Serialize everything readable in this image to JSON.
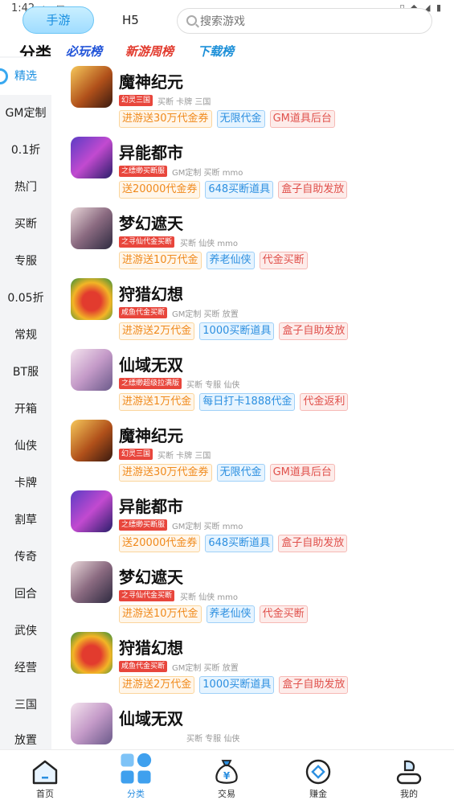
{
  "status_bar": {
    "time": "1:42"
  },
  "top_tabs": {
    "mobile_game": "手游",
    "h5": "H5"
  },
  "search": {
    "placeholder": "搜索游戏"
  },
  "category_header": {
    "title": "分类",
    "rank_must_play": "必玩榜",
    "rank_new_games": "新游周榜",
    "rank_downloads": "下载榜"
  },
  "sidebar": {
    "items": [
      "精选",
      "GM定制",
      "0.1折",
      "热门",
      "买断",
      "专服",
      "0.05折",
      "常规",
      "BT服",
      "开箱",
      "仙侠",
      "卡牌",
      "割草",
      "传奇",
      "回合",
      "武侠",
      "经营",
      "三国",
      "放置"
    ],
    "active_index": 0
  },
  "games": [
    {
      "name": "魔神纪元",
      "badge": "幻灵三国",
      "tags": "买断  卡牌  三国",
      "chips": [
        {
          "text": "进游送30万代金券",
          "style": "o"
        },
        {
          "text": "无限代金",
          "style": "b"
        },
        {
          "text": "GM道具后台",
          "style": "r"
        }
      ]
    },
    {
      "name": "异能都市",
      "badge": "之缥缈买断服",
      "tags": "GM定制  买断  mmo",
      "chips": [
        {
          "text": "送20000代金券",
          "style": "o"
        },
        {
          "text": "648买断道具",
          "style": "b"
        },
        {
          "text": "盒子自助发放",
          "style": "r"
        }
      ]
    },
    {
      "name": "梦幻遮天",
      "badge": "之寻仙代金买断",
      "tags": "买断  仙侠  mmo",
      "chips": [
        {
          "text": "进游送10万代金",
          "style": "o"
        },
        {
          "text": "养老仙侠",
          "style": "b"
        },
        {
          "text": "代金买断",
          "style": "r"
        }
      ]
    },
    {
      "name": "狩猎幻想",
      "badge": "咸鱼代金买断",
      "tags": "GM定制  买断  放置",
      "chips": [
        {
          "text": "进游送2万代金",
          "style": "o"
        },
        {
          "text": "1000买断道具",
          "style": "b"
        },
        {
          "text": "盒子自助发放",
          "style": "r"
        }
      ]
    },
    {
      "name": "仙域无双",
      "badge": "之缥缈超级拉满版",
      "tags": "买断  专服  仙侠",
      "chips": [
        {
          "text": "进游送1万代金",
          "style": "o"
        },
        {
          "text": "每日打卡1888代金",
          "style": "b"
        },
        {
          "text": "代金返利",
          "style": "r"
        }
      ]
    },
    {
      "name": "魔神纪元",
      "badge": "幻灵三国",
      "tags": "买断  卡牌  三国",
      "chips": [
        {
          "text": "进游送30万代金券",
          "style": "o"
        },
        {
          "text": "无限代金",
          "style": "b"
        },
        {
          "text": "GM道具后台",
          "style": "r"
        }
      ]
    },
    {
      "name": "异能都市",
      "badge": "之缥缈买断服",
      "tags": "GM定制  买断  mmo",
      "chips": [
        {
          "text": "送20000代金券",
          "style": "o"
        },
        {
          "text": "648买断道具",
          "style": "b"
        },
        {
          "text": "盒子自助发放",
          "style": "r"
        }
      ]
    },
    {
      "name": "梦幻遮天",
      "badge": "之寻仙代金买断",
      "tags": "买断  仙侠  mmo",
      "chips": [
        {
          "text": "进游送10万代金",
          "style": "o"
        },
        {
          "text": "养老仙侠",
          "style": "b"
        },
        {
          "text": "代金买断",
          "style": "r"
        }
      ]
    },
    {
      "name": "狩猎幻想",
      "badge": "咸鱼代金买断",
      "tags": "GM定制  买断  放置",
      "chips": [
        {
          "text": "进游送2万代金",
          "style": "o"
        },
        {
          "text": "1000买断道具",
          "style": "b"
        },
        {
          "text": "盒子自助发放",
          "style": "r"
        }
      ]
    },
    {
      "name": "仙域无双",
      "badge": "",
      "tags": "买断  专服  仙侠",
      "chips": []
    }
  ],
  "bottom_nav": {
    "items": [
      {
        "label": "首页",
        "icon": "home-icon"
      },
      {
        "label": "分类",
        "icon": "category-grid-icon"
      },
      {
        "label": "交易",
        "icon": "money-bag-icon"
      },
      {
        "label": "赚金",
        "icon": "coin-icon"
      },
      {
        "label": "我的",
        "icon": "profile-icon"
      }
    ],
    "active_index": 1
  },
  "colors": {
    "accent": "#2c8fe0",
    "chip_orange": "#f08a1c",
    "chip_blue": "#2c8fe0",
    "chip_red": "#e0504b",
    "badge_red": "#e8463c"
  }
}
